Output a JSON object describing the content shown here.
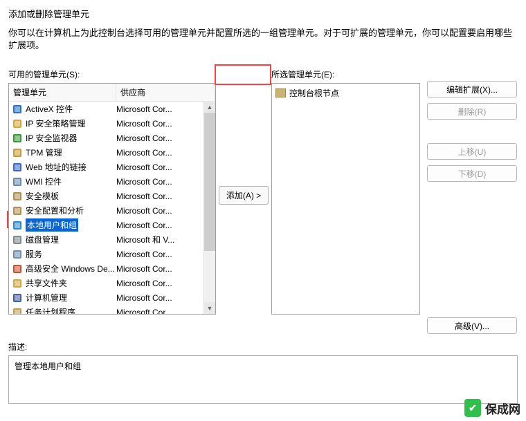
{
  "title": "添加或删除管理单元",
  "intro": "你可以在计算机上为此控制台选择可用的管理单元并配置所选的一组管理单元。对于可扩展的管理单元，你可以配置要启用哪些扩展项。",
  "available": {
    "label": "可用的管理单元(S):",
    "columns": {
      "snapin": "管理单元",
      "vendor": "供应商"
    },
    "items": [
      {
        "name": "ActiveX 控件",
        "vendor": "Microsoft Cor...",
        "icon": "activex"
      },
      {
        "name": "IP 安全策略管理",
        "vendor": "Microsoft Cor...",
        "icon": "ipsec-policy"
      },
      {
        "name": "IP 安全监视器",
        "vendor": "Microsoft Cor...",
        "icon": "ipsec-monitor"
      },
      {
        "name": "TPM 管理",
        "vendor": "Microsoft Cor...",
        "icon": "tpm"
      },
      {
        "name": "Web 地址的链接",
        "vendor": "Microsoft Cor...",
        "icon": "web-link"
      },
      {
        "name": "WMI 控件",
        "vendor": "Microsoft Cor...",
        "icon": "wmi"
      },
      {
        "name": "安全模板",
        "vendor": "Microsoft Cor...",
        "icon": "sec-template"
      },
      {
        "name": "安全配置和分析",
        "vendor": "Microsoft Cor...",
        "icon": "sec-config"
      },
      {
        "name": "本地用户和组",
        "vendor": "Microsoft Cor...",
        "icon": "local-users",
        "selected": true
      },
      {
        "name": "磁盘管理",
        "vendor": "Microsoft 和 V...",
        "icon": "disk"
      },
      {
        "name": "服务",
        "vendor": "Microsoft Cor...",
        "icon": "services"
      },
      {
        "name": "高级安全 Windows De...",
        "vendor": "Microsoft Cor...",
        "icon": "firewall"
      },
      {
        "name": "共享文件夹",
        "vendor": "Microsoft Cor...",
        "icon": "shared"
      },
      {
        "name": "计算机管理",
        "vendor": "Microsoft Cor...",
        "icon": "computer-mgmt"
      },
      {
        "name": "任务计划程序",
        "vendor": "Microsoft Cor...",
        "icon": "task-sched"
      }
    ]
  },
  "selected": {
    "label": "所选管理单元(E):",
    "root": "控制台根节点"
  },
  "buttons": {
    "add": "添加(A) >",
    "edit_ext": "编辑扩展(X)...",
    "remove": "删除(R)",
    "move_up": "上移(U)",
    "move_down": "下移(D)",
    "advanced": "高级(V)..."
  },
  "description": {
    "label": "描述:",
    "text": "管理本地用户和组"
  },
  "watermark": "保成网"
}
